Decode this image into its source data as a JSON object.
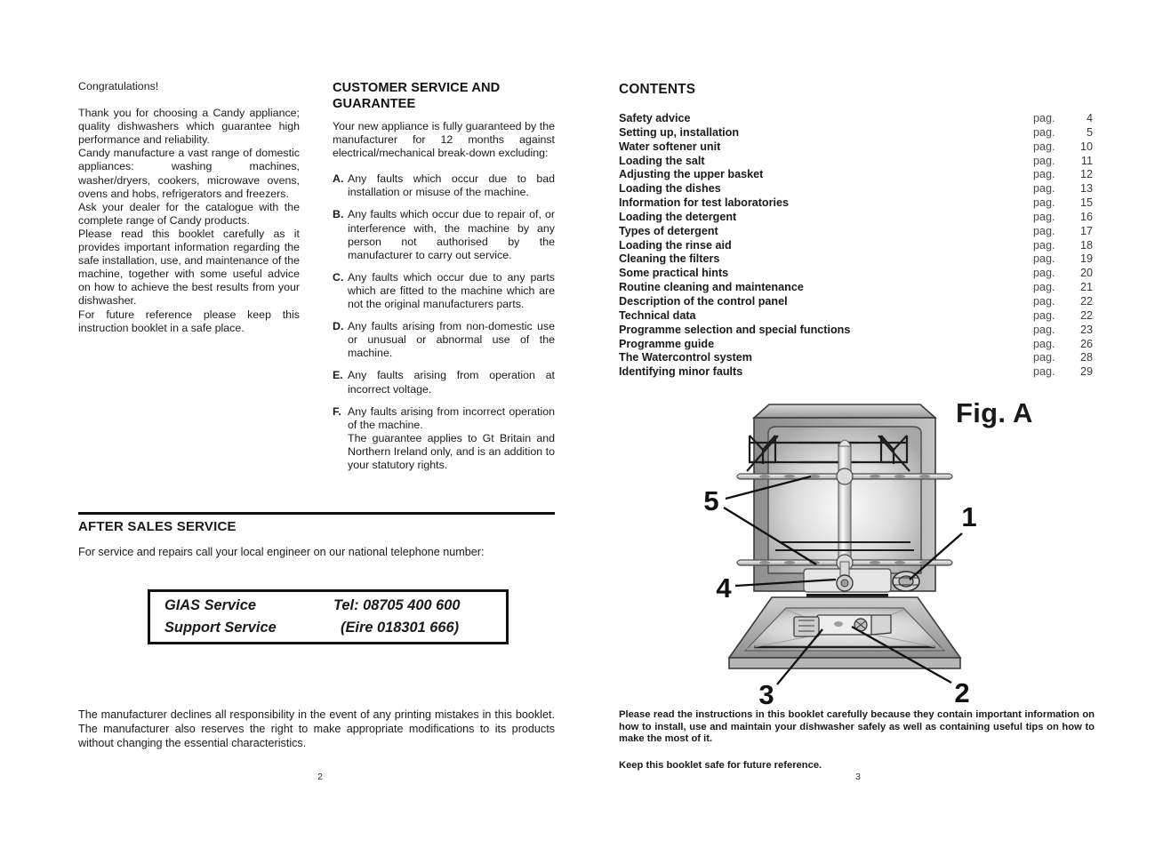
{
  "left_page": {
    "folio": "2",
    "intro": {
      "greeting": "Congratulations!",
      "paragraphs": [
        "Thank you for choosing a Candy appliance; quality dishwashers which guarantee high performance and reliability.",
        "Candy manufacture a vast range of domestic appliances: washing machines, washer/dryers, cookers, microwave ovens, ovens and hobs, refrigerators and freezers.",
        "Ask your dealer for the catalogue with the complete range of Candy products.",
        "Please read this booklet carefully  as it provides important information regarding the safe installation, use, and maintenance of the machine, together with some useful advice on how to achieve the best results from your dishwasher.",
        "For future reference please keep this instruction booklet in a safe place."
      ]
    },
    "guarantee": {
      "title": "CUSTOMER SERVICE AND GUARANTEE",
      "intro": "Your new appliance is fully guaranteed by the manufacturer for 12 months against electrical/mechanical break-down excluding:",
      "items": [
        {
          "letter": "A.",
          "text": "Any faults which occur due to bad installation or misuse of the machine."
        },
        {
          "letter": "B.",
          "text": "Any faults which occur due to repair of, or interference with, the machine by any person not authorised by the manufacturer to carry out service."
        },
        {
          "letter": "C.",
          "text": "Any faults which occur due to any parts which are fitted to the machine which are not the original manufacturers parts."
        },
        {
          "letter": "D.",
          "text": "Any faults arising from non-domestic use or unusual or abnormal use of the machine."
        },
        {
          "letter": "E.",
          "text": "Any faults arising from operation at incorrect voltage."
        },
        {
          "letter": "F.",
          "text": "Any faults arising from incorrect operation of the machine.",
          "tail": "The guarantee applies to Gt Britain and Northern Ireland only, and is an addition to your statutory rights."
        }
      ]
    },
    "after_sales": {
      "title": "AFTER SALES SERVICE",
      "subtitle": "For service and repairs call your local engineer on our national telephone number:",
      "box": {
        "row1_left": "GIAS Service",
        "row1_right": "Tel: 08705 400 600",
        "row2_left": "Support Service",
        "row2_right": "(Eire 018301 666)"
      }
    },
    "disclaimer": "The manufacturer declines all responsibility in the event of any printing mistakes in this booklet. The manufacturer also reserves the right to make appropriate modifications to its products without changing the essential characteristics."
  },
  "right_page": {
    "folio": "3",
    "contents_title": "CONTENTS",
    "pag_label": "pag.",
    "contents": [
      {
        "label": "Safety advice",
        "page": "4"
      },
      {
        "label": "Setting up, installation",
        "page": "5"
      },
      {
        "label": "Water softener unit",
        "page": "10"
      },
      {
        "label": "Loading the salt",
        "page": "11"
      },
      {
        "label": "Adjusting the upper basket",
        "page": "12"
      },
      {
        "label": "Loading the dishes",
        "page": "13"
      },
      {
        "label": "Information for test laboratories",
        "page": "15"
      },
      {
        "label": "Loading the detergent",
        "page": "16"
      },
      {
        "label": "Types of detergent",
        "page": "17"
      },
      {
        "label": "Loading the rinse aid",
        "page": "18"
      },
      {
        "label": "Cleaning the filters",
        "page": "19"
      },
      {
        "label": "Some practical hints",
        "page": "20"
      },
      {
        "label": "Routine cleaning and maintenance",
        "page": "21"
      },
      {
        "label": "Description of the control panel",
        "page": "22"
      },
      {
        "label": "Technical data",
        "page": "22"
      },
      {
        "label": "Programme selection and special functions",
        "page": "23"
      },
      {
        "label": "Programme guide",
        "page": "26"
      },
      {
        "label": "The Watercontrol system",
        "page": "28"
      },
      {
        "label": "Identifying minor faults",
        "page": "29"
      }
    ],
    "figure": {
      "caption": "Fig. A",
      "callouts": [
        {
          "id": "1",
          "label": "1"
        },
        {
          "id": "2",
          "label": "2"
        },
        {
          "id": "3",
          "label": "3"
        },
        {
          "id": "4",
          "label": "4"
        },
        {
          "id": "5",
          "label": "5"
        }
      ]
    },
    "notes": {
      "note_1": "Please read the instructions in this booklet carefully because they contain important information on how to install, use and maintain your dishwasher safely as well as containing useful tips on how to make the most of it.",
      "note_2": "Keep this booklet safe for future reference."
    }
  },
  "colors": {
    "ink": "#1a1a1a",
    "paper": "#ffffff",
    "figure_light": "#e9e9e9",
    "figure_mid": "#b9b9b9",
    "figure_dark": "#8d8d8d"
  }
}
